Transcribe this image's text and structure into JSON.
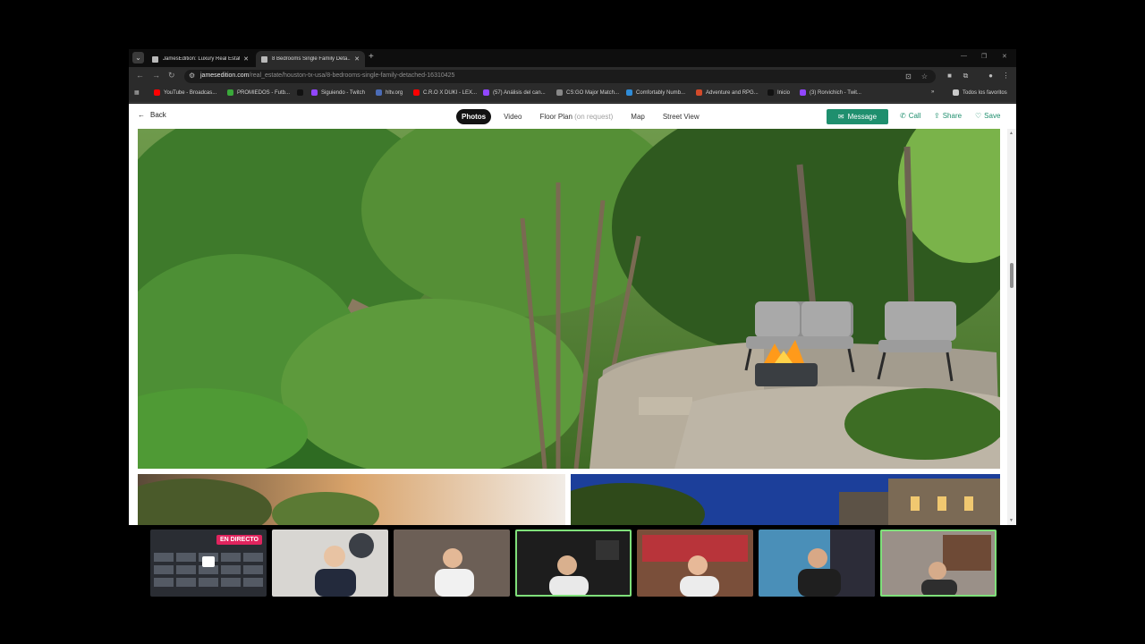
{
  "browser": {
    "tabs": [
      {
        "title": "JamesEdition: Luxury Real Estat...",
        "active": false
      },
      {
        "title": "8 Bedrooms Single Family Deta...",
        "active": true
      }
    ],
    "new_tab": "+",
    "url_host": "jamesedition.com",
    "url_path": "/real_estate/houston-tx-usa/8-bedrooms-single-family-detached-16310425",
    "bookmarks": [
      {
        "label": "YouTube - Broadcas...",
        "color": "#ff0000"
      },
      {
        "label": "PROMIEDOS - Futb...",
        "color": "#3aa93a"
      },
      {
        "label": "",
        "color": "#111111"
      },
      {
        "label": "Siguiendo - Twitch",
        "color": "#9146ff"
      },
      {
        "label": "hltv.org",
        "color": "#4b6cb7"
      },
      {
        "label": "C.R.O X DUKI - LEX...",
        "color": "#ff0000"
      },
      {
        "label": "(57) Análisis del can...",
        "color": "#9146ff"
      },
      {
        "label": "CS:GO Major Match...",
        "color": "#888888"
      },
      {
        "label": "Comfortably Numb...",
        "color": "#2f8cd8"
      },
      {
        "label": "Adventure and RPG...",
        "color": "#d34a2a"
      },
      {
        "label": "Inicio",
        "color": "#111111"
      },
      {
        "label": "(3) Rorvichich - Twit...",
        "color": "#9146ff"
      }
    ],
    "bookmarks_more": "»",
    "all_bookmarks": "Todos los favoritos"
  },
  "page": {
    "back_label": "Back",
    "nav_tabs": [
      {
        "label": "Photos",
        "active": true
      },
      {
        "label": "Video",
        "active": false
      },
      {
        "label": "Floor Plan",
        "suffix": "(on request)",
        "active": false
      },
      {
        "label": "Map",
        "active": false
      },
      {
        "label": "Street View",
        "active": false
      }
    ],
    "message_label": "Message",
    "call_label": "Call",
    "share_label": "Share",
    "save_label": "Save",
    "accent_color": "#1f8f6e"
  },
  "stream": {
    "live_badge": "EN DIRECTO",
    "cams": 7,
    "highlight_color": "#7fe07a"
  }
}
